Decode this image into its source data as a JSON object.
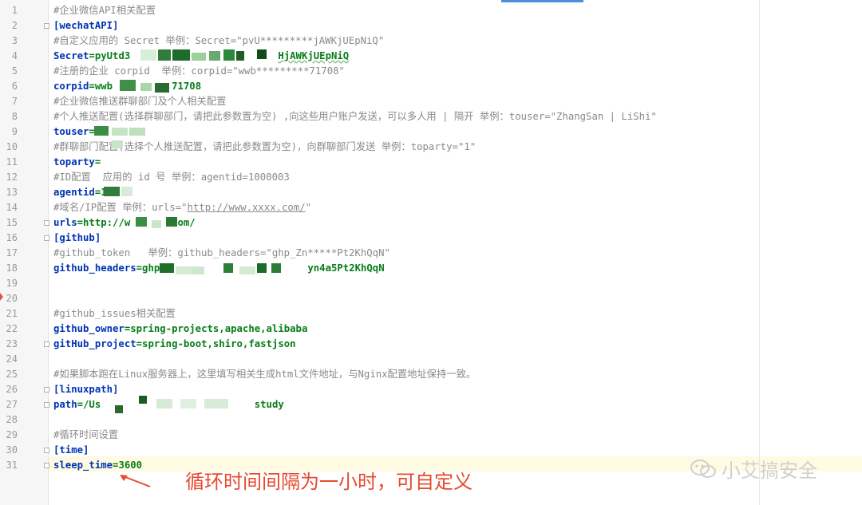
{
  "lines": [
    {
      "n": "1",
      "fold": false,
      "parts": [
        {
          "t": "#企业微信",
          "c": "c-comment"
        },
        {
          "t": "API",
          "c": "c-comment it"
        },
        {
          "t": "相关配置",
          "c": "c-comment"
        }
      ]
    },
    {
      "n": "2",
      "fold": true,
      "parts": [
        {
          "t": "[wechatAPI]",
          "c": "c-sec"
        }
      ]
    },
    {
      "n": "3",
      "fold": false,
      "parts": [
        {
          "t": "#自定义应用的 ",
          "c": "c-comment"
        },
        {
          "t": "Secret",
          "c": "c-comment it"
        },
        {
          "t": " 举例：",
          "c": "c-comment"
        },
        {
          "t": "Secret=\"pvU*********jAWKjUEpNiQ\"",
          "c": "c-comment it"
        }
      ]
    },
    {
      "n": "4",
      "fold": false,
      "parts": [
        {
          "t": "Secret",
          "c": "c-key"
        },
        {
          "t": "=pyUtd3",
          "c": "c-val"
        },
        {
          "t": "                         ",
          "c": "c-val"
        },
        {
          "t": "HjAWKjUEpNiQ",
          "c": "c-val squig"
        }
      ]
    },
    {
      "n": "5",
      "fold": false,
      "parts": [
        {
          "t": "#注册的企业 ",
          "c": "c-comment"
        },
        {
          "t": "corpid",
          "c": "c-comment it"
        },
        {
          "t": "  举例：",
          "c": "c-comment"
        },
        {
          "t": "corpid=\"wwb*********71708\"",
          "c": "c-comment it"
        }
      ]
    },
    {
      "n": "6",
      "fold": false,
      "parts": [
        {
          "t": "corpid",
          "c": "c-key"
        },
        {
          "t": "=wwb",
          "c": "c-val"
        },
        {
          "t": "          ",
          "c": "c-val"
        },
        {
          "t": "71708",
          "c": "c-val"
        }
      ]
    },
    {
      "n": "7",
      "fold": false,
      "parts": [
        {
          "t": "#企业微信推送群聊部门及个人相关配置",
          "c": "c-comment"
        }
      ]
    },
    {
      "n": "8",
      "fold": false,
      "parts": [
        {
          "t": "#个人推送配置(选择群聊部门，请把此参数置为空) ,向这些用户账户发送，可以多人用 | 隔开 举例：",
          "c": "c-comment"
        },
        {
          "t": "touser=\"ZhangSan | LiShi\"",
          "c": "c-comment it"
        }
      ]
    },
    {
      "n": "9",
      "fold": false,
      "parts": [
        {
          "t": "touser",
          "c": "c-key"
        },
        {
          "t": "=L",
          "c": "c-val"
        }
      ]
    },
    {
      "n": "10",
      "fold": false,
      "parts": [
        {
          "t": "#群聊部门配置(选择个人推送配置，请把此参数置为空)，向群聊部门发送 举例：",
          "c": "c-comment"
        },
        {
          "t": "toparty=\"1\"",
          "c": "c-comment it"
        }
      ]
    },
    {
      "n": "11",
      "fold": false,
      "parts": [
        {
          "t": "toparty",
          "c": "c-key"
        },
        {
          "t": "=",
          "c": "c-val"
        }
      ]
    },
    {
      "n": "12",
      "fold": false,
      "parts": [
        {
          "t": "#ID",
          "c": "c-comment it"
        },
        {
          "t": "配置  应用的 ",
          "c": "c-comment"
        },
        {
          "t": "id",
          "c": "c-comment it"
        },
        {
          "t": " 号 举例：",
          "c": "c-comment"
        },
        {
          "t": "agentid=1000003",
          "c": "c-comment it"
        }
      ]
    },
    {
      "n": "13",
      "fold": false,
      "parts": [
        {
          "t": "agentid",
          "c": "c-key"
        },
        {
          "t": "=1",
          "c": "c-val"
        }
      ]
    },
    {
      "n": "14",
      "fold": false,
      "parts": [
        {
          "t": "#域名/",
          "c": "c-comment"
        },
        {
          "t": "IP",
          "c": "c-comment it"
        },
        {
          "t": "配置 举例：",
          "c": "c-comment"
        },
        {
          "t": "urls=\"",
          "c": "c-comment it"
        },
        {
          "t": "http://www.xxxx.com/",
          "c": "c-comment it u"
        },
        {
          "t": "\"",
          "c": "c-comment it"
        }
      ]
    },
    {
      "n": "15",
      "fold": true,
      "parts": [
        {
          "t": "urls",
          "c": "c-key"
        },
        {
          "t": "=http://w",
          "c": "c-val"
        },
        {
          "t": "        ",
          "c": "c-val"
        },
        {
          "t": "om/",
          "c": "c-val"
        }
      ]
    },
    {
      "n": "16",
      "fold": true,
      "parts": [
        {
          "t": "[github]",
          "c": "c-sec"
        }
      ]
    },
    {
      "n": "17",
      "fold": false,
      "parts": [
        {
          "t": "#github_token",
          "c": "c-comment it"
        },
        {
          "t": "   举例：",
          "c": "c-comment"
        },
        {
          "t": "github_headers=\"ghp_Zn*****Pt2KhQqN\"",
          "c": "c-comment it"
        }
      ]
    },
    {
      "n": "18",
      "fold": false,
      "parts": [
        {
          "t": "github_headers",
          "c": "c-key"
        },
        {
          "t": "=ghp",
          "c": "c-val"
        },
        {
          "t": "                         ",
          "c": "c-val"
        },
        {
          "t": "yn4a5Pt2KhQqN",
          "c": "c-val"
        }
      ]
    },
    {
      "n": "19",
      "fold": false,
      "parts": []
    },
    {
      "n": "20",
      "fold": false,
      "parts": []
    },
    {
      "n": "21",
      "fold": false,
      "parts": [
        {
          "t": "#github_issues",
          "c": "c-comment it"
        },
        {
          "t": "相关配置",
          "c": "c-comment"
        }
      ]
    },
    {
      "n": "22",
      "fold": false,
      "parts": [
        {
          "t": "github_owner",
          "c": "c-key"
        },
        {
          "t": "=spring-projects,apache,alibaba",
          "c": "c-val"
        }
      ]
    },
    {
      "n": "23",
      "fold": true,
      "parts": [
        {
          "t": "gitHub_project",
          "c": "c-key"
        },
        {
          "t": "=spring-boot,shiro,fastjson",
          "c": "c-val"
        }
      ]
    },
    {
      "n": "24",
      "fold": false,
      "parts": []
    },
    {
      "n": "25",
      "fold": false,
      "parts": [
        {
          "t": "#如果脚本跑在",
          "c": "c-comment"
        },
        {
          "t": "Linux",
          "c": "c-comment it"
        },
        {
          "t": "服务器上，这里填写相关生成",
          "c": "c-comment"
        },
        {
          "t": "html",
          "c": "c-comment it"
        },
        {
          "t": "文件地址，与",
          "c": "c-comment"
        },
        {
          "t": "Nginx",
          "c": "c-comment it"
        },
        {
          "t": "配置地址保持一致。",
          "c": "c-comment"
        }
      ]
    },
    {
      "n": "26",
      "fold": true,
      "parts": [
        {
          "t": "[linuxpath]",
          "c": "c-sec"
        }
      ]
    },
    {
      "n": "27",
      "fold": true,
      "parts": [
        {
          "t": "path",
          "c": "c-key"
        },
        {
          "t": "=/Us",
          "c": "c-val"
        },
        {
          "t": "                          ",
          "c": "c-val"
        },
        {
          "t": "study",
          "c": "c-val"
        }
      ]
    },
    {
      "n": "28",
      "fold": false,
      "parts": []
    },
    {
      "n": "29",
      "fold": false,
      "parts": [
        {
          "t": "#循环时间设置",
          "c": "c-comment"
        }
      ]
    },
    {
      "n": "30",
      "fold": true,
      "parts": [
        {
          "t": "[time]",
          "c": "c-sec"
        }
      ]
    },
    {
      "n": "31",
      "fold": true,
      "parts": [
        {
          "t": "sleep_time",
          "c": "c-key"
        },
        {
          "t": "=3600",
          "c": "c-val"
        }
      ]
    }
  ],
  "annotation": {
    "text": "循环时间间隔为一小时，可自定义",
    "color": "#e64a2e"
  },
  "watermark": {
    "text": "小艾搞安全",
    "icon": "wechat-icon"
  }
}
